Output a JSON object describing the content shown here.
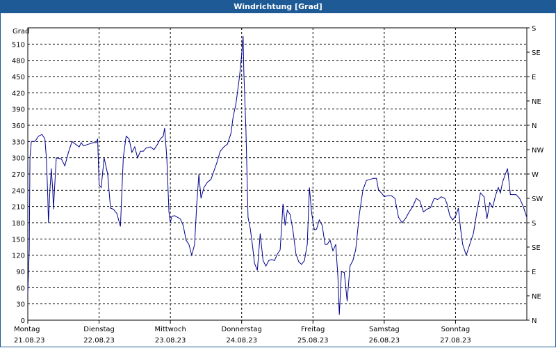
{
  "window": {
    "title": "Windrichtung [Grad]"
  },
  "chart_data": {
    "type": "line",
    "ylabel": "Grad",
    "ylim": [
      0,
      540
    ],
    "y_ticks": [
      0,
      30,
      60,
      90,
      120,
      150,
      180,
      210,
      240,
      270,
      300,
      330,
      360,
      390,
      420,
      450,
      480,
      510
    ],
    "right_ticks": [
      "N",
      "NE",
      "E",
      "SE",
      "S",
      "SW",
      "W",
      "NW",
      "N",
      "NE",
      "E",
      "SE",
      "S"
    ],
    "x_ticks": [
      {
        "day": "Montag",
        "date": "21.08.23"
      },
      {
        "day": "Dienstag",
        "date": "22.08.23"
      },
      {
        "day": "Mittwoch",
        "date": "23.08.23"
      },
      {
        "day": "Donnerstag",
        "date": "24.08.23"
      },
      {
        "day": "Freitag",
        "date": "25.08.23"
      },
      {
        "day": "Samstag",
        "date": "26.08.23"
      },
      {
        "day": "Sonntag",
        "date": "27.08.23"
      }
    ],
    "x_unit": "days since 21.08.23 00:00",
    "xlim": [
      0,
      7
    ],
    "grid": true,
    "line_color": "#00008b",
    "series": [
      {
        "values": [
          [
            0.0,
            50
          ],
          [
            0.02,
            130
          ],
          [
            0.03,
            300
          ],
          [
            0.05,
            330
          ],
          [
            0.1,
            330
          ],
          [
            0.15,
            340
          ],
          [
            0.2,
            343
          ],
          [
            0.24,
            335
          ],
          [
            0.26,
            300
          ],
          [
            0.28,
            230
          ],
          [
            0.29,
            180
          ],
          [
            0.31,
            240
          ],
          [
            0.33,
            280
          ],
          [
            0.35,
            240
          ],
          [
            0.36,
            205
          ],
          [
            0.38,
            255
          ],
          [
            0.4,
            300
          ],
          [
            0.47,
            298
          ],
          [
            0.52,
            285
          ],
          [
            0.57,
            310
          ],
          [
            0.62,
            330
          ],
          [
            0.67,
            325
          ],
          [
            0.72,
            320
          ],
          [
            0.75,
            328
          ],
          [
            0.78,
            322
          ],
          [
            0.85,
            325
          ],
          [
            0.92,
            328
          ],
          [
            0.96,
            328
          ],
          [
            0.98,
            335
          ],
          [
            1.0,
            250
          ],
          [
            1.03,
            245
          ],
          [
            1.07,
            300
          ],
          [
            1.12,
            270
          ],
          [
            1.16,
            207
          ],
          [
            1.2,
            205
          ],
          [
            1.25,
            197
          ],
          [
            1.3,
            173
          ],
          [
            1.34,
            300
          ],
          [
            1.38,
            340
          ],
          [
            1.42,
            335
          ],
          [
            1.46,
            310
          ],
          [
            1.5,
            320
          ],
          [
            1.54,
            300
          ],
          [
            1.58,
            312
          ],
          [
            1.62,
            312
          ],
          [
            1.66,
            318
          ],
          [
            1.72,
            320
          ],
          [
            1.77,
            315
          ],
          [
            1.82,
            325
          ],
          [
            1.86,
            335
          ],
          [
            1.9,
            340
          ],
          [
            1.92,
            355
          ],
          [
            1.95,
            300
          ],
          [
            1.98,
            200
          ],
          [
            2.0,
            180
          ],
          [
            2.02,
            192
          ],
          [
            2.06,
            193
          ],
          [
            2.1,
            190
          ],
          [
            2.14,
            187
          ],
          [
            2.18,
            175
          ],
          [
            2.22,
            148
          ],
          [
            2.26,
            140
          ],
          [
            2.3,
            120
          ],
          [
            2.34,
            140
          ],
          [
            2.37,
            215
          ],
          [
            2.4,
            270
          ],
          [
            2.43,
            225
          ],
          [
            2.47,
            245
          ],
          [
            2.52,
            255
          ],
          [
            2.57,
            260
          ],
          [
            2.61,
            275
          ],
          [
            2.65,
            290
          ],
          [
            2.7,
            312
          ],
          [
            2.75,
            320
          ],
          [
            2.8,
            325
          ],
          [
            2.85,
            345
          ],
          [
            2.88,
            375
          ],
          [
            2.92,
            400
          ],
          [
            2.95,
            430
          ],
          [
            2.97,
            450
          ],
          [
            3.0,
            490
          ],
          [
            3.02,
            525
          ],
          [
            3.03,
            460
          ],
          [
            3.06,
            350
          ],
          [
            3.09,
            190
          ],
          [
            3.12,
            170
          ],
          [
            3.15,
            140
          ],
          [
            3.18,
            105
          ],
          [
            3.22,
            92
          ],
          [
            3.26,
            160
          ],
          [
            3.3,
            110
          ],
          [
            3.34,
            100
          ],
          [
            3.38,
            110
          ],
          [
            3.42,
            112
          ],
          [
            3.46,
            110
          ],
          [
            3.5,
            122
          ],
          [
            3.54,
            130
          ],
          [
            3.58,
            215
          ],
          [
            3.61,
            175
          ],
          [
            3.64,
            203
          ],
          [
            3.68,
            195
          ],
          [
            3.72,
            165
          ],
          [
            3.76,
            123
          ],
          [
            3.8,
            108
          ],
          [
            3.84,
            103
          ],
          [
            3.88,
            110
          ],
          [
            3.92,
            140
          ],
          [
            3.95,
            245
          ],
          [
            3.98,
            200
          ],
          [
            4.02,
            167
          ],
          [
            4.05,
            168
          ],
          [
            4.09,
            185
          ],
          [
            4.13,
            175
          ],
          [
            4.17,
            140
          ],
          [
            4.2,
            140
          ],
          [
            4.24,
            148
          ],
          [
            4.28,
            128
          ],
          [
            4.32,
            140
          ],
          [
            4.35,
            80
          ],
          [
            4.37,
            10
          ],
          [
            4.4,
            90
          ],
          [
            4.44,
            88
          ],
          [
            4.48,
            35
          ],
          [
            4.52,
            100
          ],
          [
            4.56,
            110
          ],
          [
            4.6,
            130
          ],
          [
            4.65,
            195
          ],
          [
            4.7,
            240
          ],
          [
            4.75,
            258
          ],
          [
            4.8,
            260
          ],
          [
            4.85,
            262
          ],
          [
            4.89,
            262
          ],
          [
            4.92,
            240
          ],
          [
            4.96,
            235
          ],
          [
            5.0,
            228
          ],
          [
            5.05,
            230
          ],
          [
            5.1,
            230
          ],
          [
            5.15,
            225
          ],
          [
            5.2,
            190
          ],
          [
            5.25,
            180
          ],
          [
            5.3,
            188
          ],
          [
            5.35,
            200
          ],
          [
            5.4,
            210
          ],
          [
            5.45,
            225
          ],
          [
            5.5,
            220
          ],
          [
            5.55,
            200
          ],
          [
            5.6,
            205
          ],
          [
            5.65,
            208
          ],
          [
            5.7,
            225
          ],
          [
            5.75,
            223
          ],
          [
            5.8,
            228
          ],
          [
            5.85,
            225
          ],
          [
            5.88,
            215
          ],
          [
            5.92,
            193
          ],
          [
            5.96,
            185
          ],
          [
            6.0,
            192
          ],
          [
            6.04,
            207
          ],
          [
            6.07,
            170
          ],
          [
            6.1,
            140
          ],
          [
            6.15,
            120
          ],
          [
            6.2,
            140
          ],
          [
            6.25,
            160
          ],
          [
            6.3,
            200
          ],
          [
            6.35,
            235
          ],
          [
            6.4,
            228
          ],
          [
            6.44,
            187
          ],
          [
            6.48,
            217
          ],
          [
            6.52,
            208
          ],
          [
            6.56,
            230
          ],
          [
            6.6,
            245
          ],
          [
            6.63,
            235
          ],
          [
            6.66,
            255
          ],
          [
            6.7,
            270
          ],
          [
            6.73,
            280
          ],
          [
            6.77,
            232
          ],
          [
            6.85,
            232
          ],
          [
            6.9,
            225
          ],
          [
            6.95,
            210
          ],
          [
            7.0,
            190
          ]
        ]
      }
    ]
  }
}
